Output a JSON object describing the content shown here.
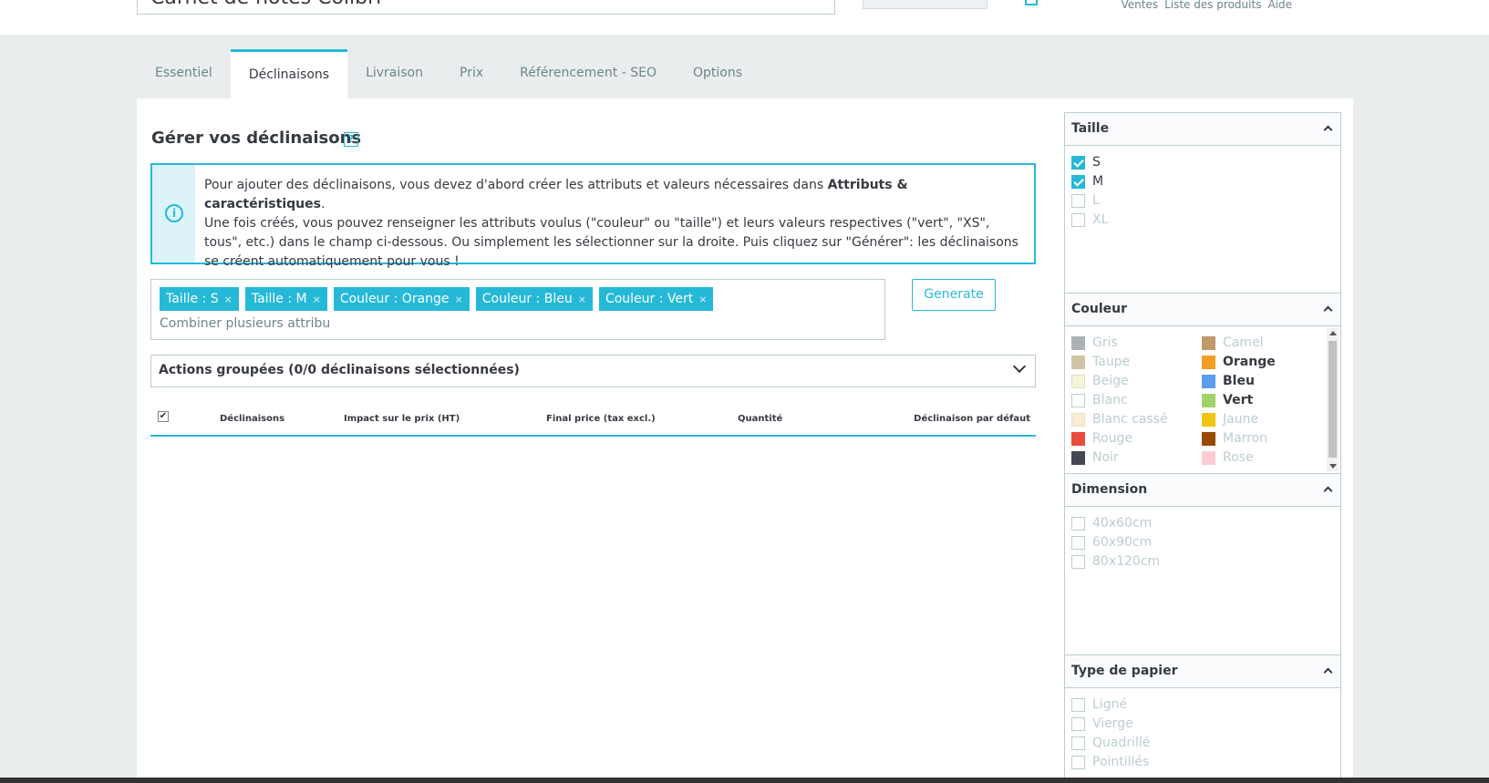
{
  "header": {
    "title_value": "Carnet de notes Colibri",
    "links": [
      "Ventes",
      "Liste des produits",
      "Aide"
    ]
  },
  "tabs": [
    {
      "label": "Essentiel",
      "active": false
    },
    {
      "label": "Déclinaisons",
      "active": true
    },
    {
      "label": "Livraison",
      "active": false
    },
    {
      "label": "Prix",
      "active": false
    },
    {
      "label": "Référencement - SEO",
      "active": false
    },
    {
      "label": "Options",
      "active": false
    }
  ],
  "main": {
    "heading": "Gérer vos déclinaisons",
    "help_label": "?",
    "alert": {
      "icon": "info-icon",
      "text_before": "Pour ajouter des déclinaisons, vous devez d'abord créer les attributs et valeurs nécessaires dans ",
      "text_link": "Attributs & caractéristiques",
      "text_after": ".",
      "line2": "Une fois créés, vous pouvez renseigner les attributs voulus (\"couleur\" ou \"taille\") et leurs valeurs respectives (\"vert\", \"XS\", tous\", etc.) dans le champ ci-dessous. Ou simplement les sélectionner sur la droite. Puis cliquez sur \"Générer\": les déclinaisons se créent automatiquement pour vous !"
    },
    "tokens": [
      "Taille : S",
      "Taille : M",
      "Couleur : Orange",
      "Couleur : Bleu",
      "Couleur : Vert"
    ],
    "token_remove": "×",
    "token_input_placeholder": "Combiner plusieurs attribu",
    "generate_label": "Generate",
    "bulk_label": "Actions groupées (0/0 déclinaisons sélectionnées)",
    "table_headers": [
      "Déclinaisons",
      "Impact sur le prix (HT)",
      "Final price (tax excl.)",
      "Quantité",
      "Déclinaison par défaut"
    ]
  },
  "sidebar": {
    "groups": [
      {
        "title": "Taille",
        "options": [
          {
            "label": "S",
            "checked": true
          },
          {
            "label": "M",
            "checked": true
          },
          {
            "label": "L",
            "checked": false
          },
          {
            "label": "XL",
            "checked": false
          }
        ]
      },
      {
        "title": "Couleur",
        "colors": [
          {
            "label": "Gris",
            "color": "#aab2b8",
            "checked": false
          },
          {
            "label": "Camel",
            "color": "#c19a6b",
            "checked": false
          },
          {
            "label": "Taupe",
            "color": "#cfc4a6",
            "checked": false
          },
          {
            "label": "Orange",
            "color": "#f39d24",
            "checked": true
          },
          {
            "label": "Beige",
            "color": "#f5f5dc",
            "checked": false
          },
          {
            "label": "Bleu",
            "color": "#5d9cec",
            "checked": true
          },
          {
            "label": "Blanc",
            "color": "#ffffff",
            "checked": false
          },
          {
            "label": "Vert",
            "color": "#a0d468",
            "checked": true
          },
          {
            "label": "Blanc cassé",
            "color": "#faebd7",
            "checked": false
          },
          {
            "label": "Jaune",
            "color": "#f1c40f",
            "checked": false
          },
          {
            "label": "Rouge",
            "color": "#e84c3d",
            "checked": false
          },
          {
            "label": "Marron",
            "color": "#964b00",
            "checked": false
          },
          {
            "label": "Noir",
            "color": "#434a54",
            "checked": false
          },
          {
            "label": "Rose",
            "color": "#fcccd4",
            "checked": false
          }
        ]
      },
      {
        "title": "Dimension",
        "options": [
          {
            "label": "40x60cm",
            "checked": false
          },
          {
            "label": "60x90cm",
            "checked": false
          },
          {
            "label": "80x120cm",
            "checked": false
          }
        ]
      },
      {
        "title": "Type de papier",
        "options": [
          {
            "label": "Ligné",
            "checked": false
          },
          {
            "label": "Vierge",
            "checked": false
          },
          {
            "label": "Quadrillé",
            "checked": false
          },
          {
            "label": "Pointillés",
            "checked": false
          }
        ]
      }
    ]
  },
  "colors": {
    "accent": "#25b9d7",
    "alert_bg": "#dcf4f9",
    "text": "#363a41",
    "muted": "#6c868e",
    "disabled": "#bbcdd2"
  }
}
